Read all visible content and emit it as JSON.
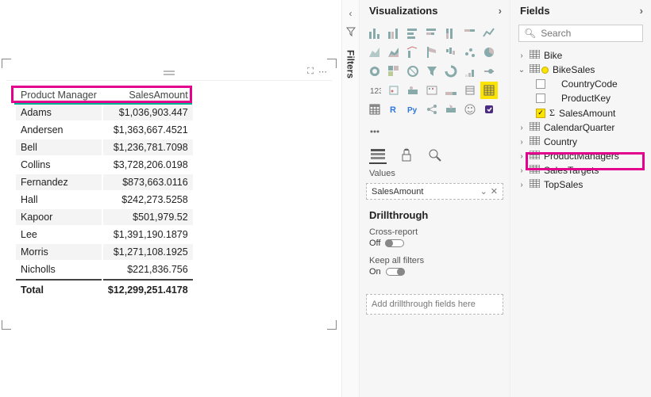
{
  "canvas": {
    "table": {
      "columns": [
        "Product Manager",
        "SalesAmount"
      ],
      "rows": [
        {
          "pm": "Adams",
          "amount": "$1,036,903.447"
        },
        {
          "pm": "Andersen",
          "amount": "$1,363,667.4521"
        },
        {
          "pm": "Bell",
          "amount": "$1,236,781.7098"
        },
        {
          "pm": "Collins",
          "amount": "$3,728,206.0198"
        },
        {
          "pm": "Fernandez",
          "amount": "$873,663.0116"
        },
        {
          "pm": "Hall",
          "amount": "$242,273.5258"
        },
        {
          "pm": "Kapoor",
          "amount": "$501,979.52"
        },
        {
          "pm": "Lee",
          "amount": "$1,391,190.1879"
        },
        {
          "pm": "Morris",
          "amount": "$1,271,108.1925"
        },
        {
          "pm": "Nicholls",
          "amount": "$221,836.756"
        }
      ],
      "total_label": "Total",
      "total_amount": "$12,299,251.4178"
    }
  },
  "filters": {
    "title": "Filters"
  },
  "viz": {
    "title": "Visualizations",
    "well_label": "Values",
    "well_field": "SalesAmount",
    "drill": {
      "title": "Drillthrough",
      "cross_label": "Cross-report",
      "cross_state": "Off",
      "keep_label": "Keep all filters",
      "keep_state": "On",
      "drop_hint": "Add drillthrough fields here"
    }
  },
  "fields": {
    "title": "Fields",
    "search_placeholder": "Search",
    "tables": [
      {
        "name": "Bike",
        "expanded": false
      },
      {
        "name": "BikeSales",
        "expanded": true,
        "active": true,
        "columns": [
          {
            "name": "CountryCode",
            "checked": false
          },
          {
            "name": "ProductKey",
            "checked": false
          },
          {
            "name": "SalesAmount",
            "checked": true,
            "sigma": true
          }
        ]
      },
      {
        "name": "CalendarQuarter",
        "expanded": false
      },
      {
        "name": "Country",
        "expanded": false
      },
      {
        "name": "ProductManagers",
        "expanded": false
      },
      {
        "name": "SalesTargets",
        "expanded": false
      },
      {
        "name": "TopSales",
        "expanded": false
      }
    ]
  },
  "colors": {
    "highlight": "#e3008c",
    "accent": "#fde300"
  }
}
